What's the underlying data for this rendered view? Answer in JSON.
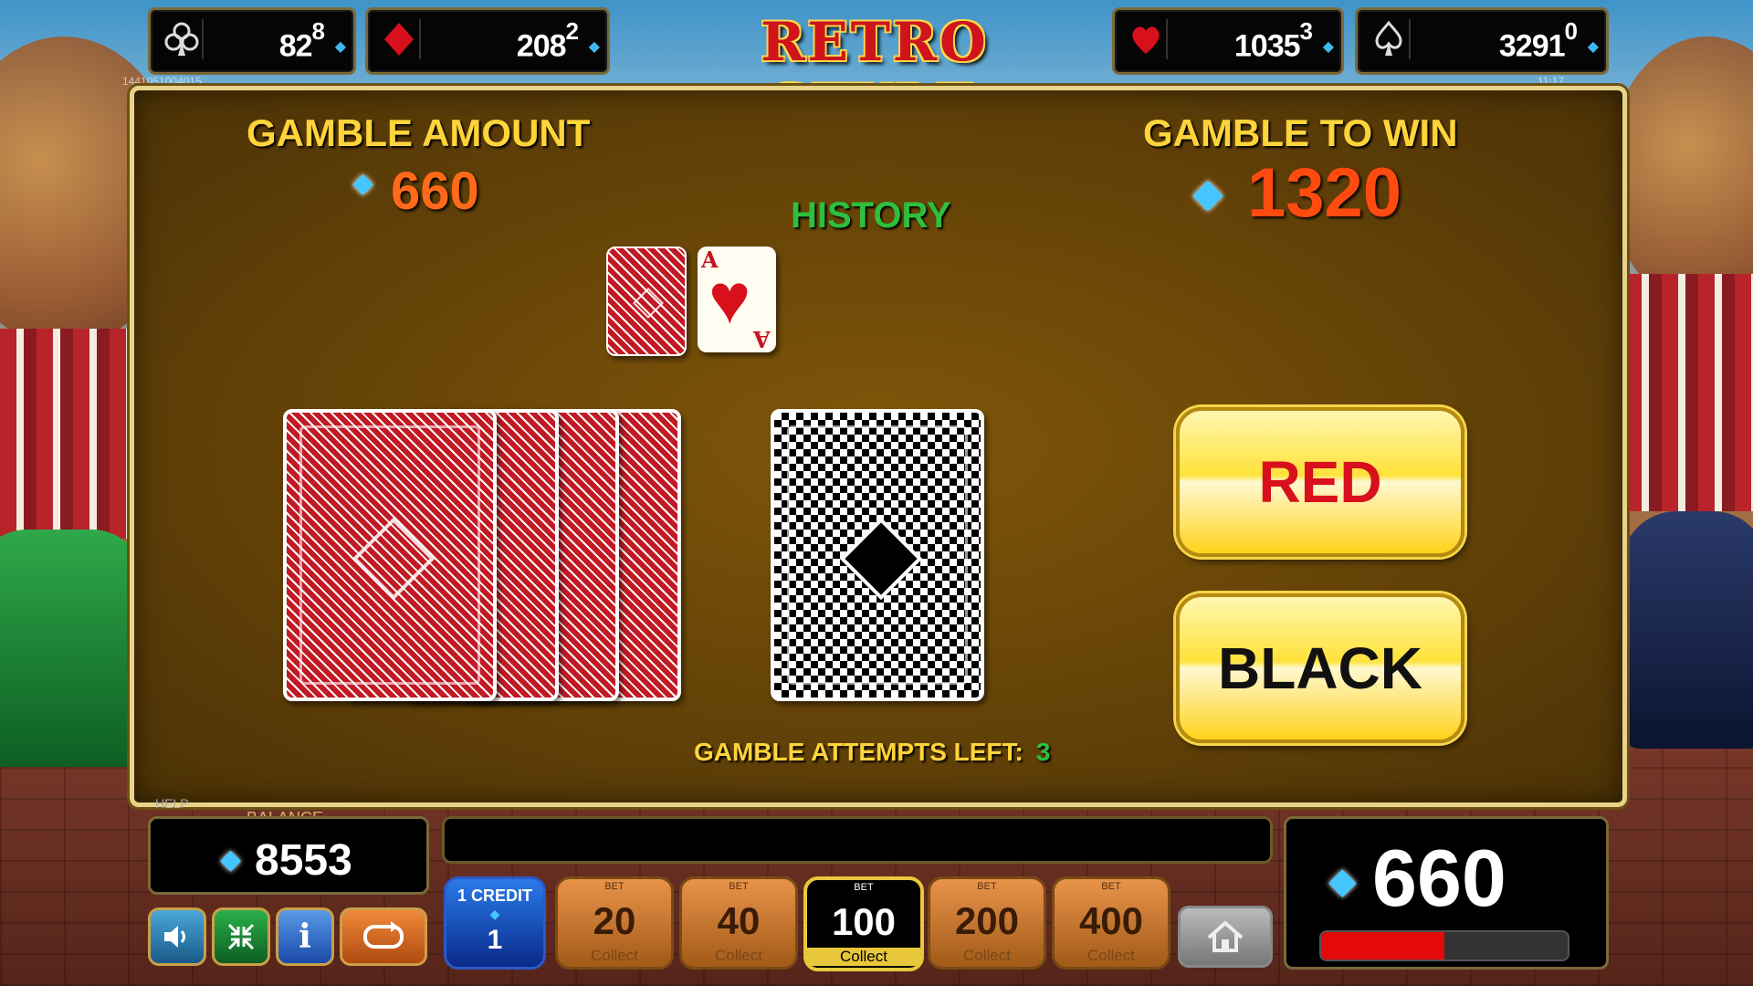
{
  "jackpots": [
    {
      "suit": "clubs-icon",
      "value": "82",
      "sup": "8"
    },
    {
      "suit": "diamonds-icon",
      "value": "208",
      "sup": "2"
    },
    {
      "suit": "hearts-icon",
      "value": "1035",
      "sup": "3"
    },
    {
      "suit": "spades-icon",
      "value": "3291",
      "sup": "0"
    }
  ],
  "logo": "RETRO STYLE",
  "left_small_text": "1441051004015",
  "right_small_text": "11:17",
  "gamble": {
    "amount_label": "GAMBLE AMOUNT",
    "amount_value": "660",
    "to_win_label": "GAMBLE TO WIN",
    "to_win_value": "1320",
    "history_label": "HISTORY",
    "history_cards": [
      {
        "type": "back-red"
      },
      {
        "type": "face",
        "rank": "A",
        "suit": "hearts"
      }
    ],
    "red_button": "RED",
    "black_button": "BLACK",
    "attempts_label": "GAMBLE ATTEMPTS LEFT:",
    "attempts_value": "3"
  },
  "bottom": {
    "help_label": "HELP",
    "balance_label": "BALANCE",
    "balance_value": "8553",
    "credit_label": "1 CREDIT",
    "credit_value": "1",
    "bet_label": "BET",
    "collect_label": "Collect",
    "bets": [
      "20",
      "40",
      "100",
      "200",
      "400"
    ],
    "active_bet": "100",
    "win_value": "660",
    "colors": {
      "accent": "#ffd43a",
      "diamond": "#46c6ff",
      "amount": "#ff6a1a",
      "history": "#2fbf3c"
    }
  }
}
